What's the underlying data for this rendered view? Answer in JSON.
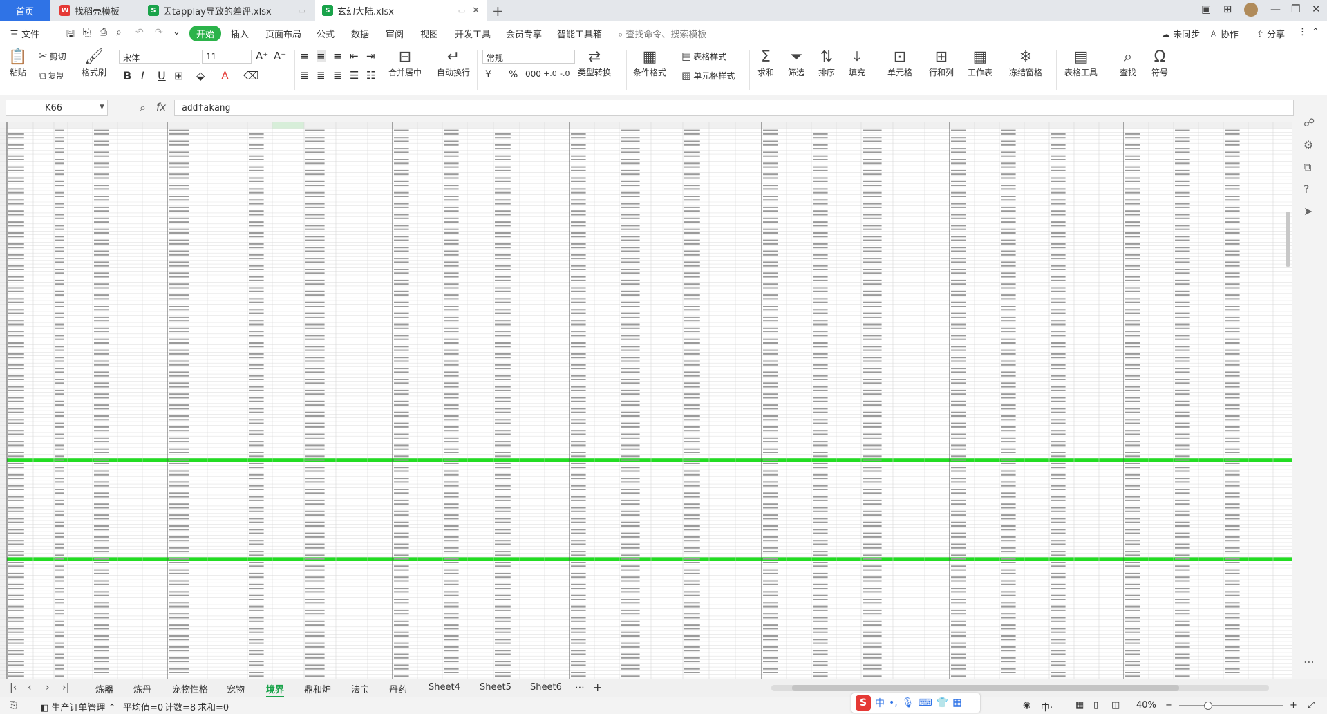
{
  "tabs": {
    "home": "首页",
    "t1": "找稻壳模板",
    "t2": "因tapplay导致的差评.xlsx",
    "t3": "玄幻大陆.xlsx"
  },
  "menu": {
    "file": "三 文件",
    "items": [
      "开始",
      "插入",
      "页面布局",
      "公式",
      "数据",
      "审阅",
      "视图",
      "开发工具",
      "会员专享",
      "智能工具箱"
    ],
    "search": "查找命令、搜索模板",
    "sync": "未同步",
    "collab": "协作",
    "share": "分享"
  },
  "ribbon": {
    "paste": "粘贴",
    "cut": "剪切",
    "copy": "复制",
    "format_painter": "格式刷",
    "font": "宋体",
    "size": "11",
    "merge": "合并居中",
    "wrap": "自动换行",
    "numfmt": "常规",
    "convert": "类型转换",
    "cond": "条件格式",
    "table_style": "表格样式",
    "cell_style": "单元格样式",
    "sum": "求和",
    "filter": "筛选",
    "sort": "排序",
    "fill": "填充",
    "cells": "单元格",
    "rowcol": "行和列",
    "sheet": "工作表",
    "freeze": "冻结窗格",
    "table_tools": "表格工具",
    "find": "查找",
    "symbol": "符号"
  },
  "formula": {
    "cell_ref": "K66",
    "fx": "fx",
    "value": "addfakang"
  },
  "sheet_tabs": [
    "炼器",
    "炼丹",
    "宠物性格",
    "宠物",
    "境界",
    "鼎和炉",
    "法宝",
    "丹药",
    "Sheet4",
    "Sheet5",
    "Sheet6"
  ],
  "active_sheet": "境界",
  "status": {
    "macro": "生产订单管理",
    "avg": "平均值=0",
    "count": "计数=8",
    "sum": "求和=0",
    "zoom": "40%"
  },
  "ime": {
    "lang": "中"
  },
  "colors": {
    "accent_green": "#2bb34a",
    "home_tab": "#2f73e6",
    "highlight_row": "#22dd22"
  }
}
